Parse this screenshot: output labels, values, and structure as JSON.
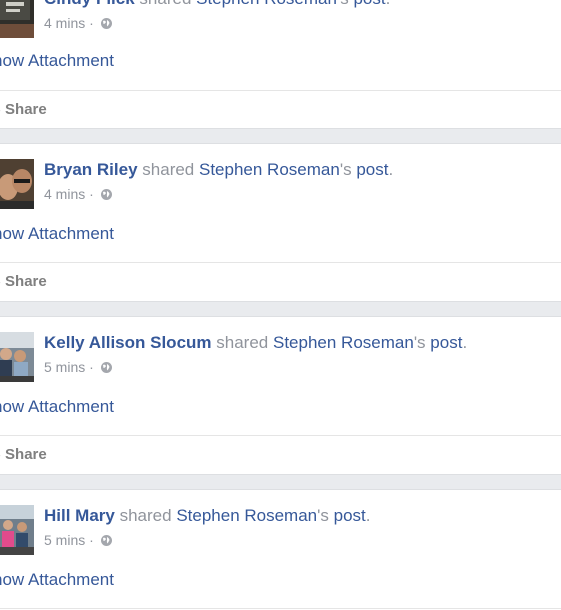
{
  "posts": [
    {
      "author": "Cindy Flick",
      "shared_word": "shared",
      "origin_author": "Stephen Roseman",
      "possessive": "'s",
      "post_word": "post",
      "period": ".",
      "time": "4 mins",
      "dot": "·",
      "attachment_label": "how Attachment",
      "share_label": "Share"
    },
    {
      "author": "Bryan Riley",
      "shared_word": "shared",
      "origin_author": "Stephen Roseman",
      "possessive": "'s",
      "post_word": "post",
      "period": ".",
      "time": "4 mins",
      "dot": "·",
      "attachment_label": "how Attachment",
      "share_label": "Share"
    },
    {
      "author": "Kelly Allison Slocum",
      "shared_word": "shared",
      "origin_author": "Stephen Roseman",
      "possessive": "'s",
      "post_word": "post",
      "period": ".",
      "time": "5 mins",
      "dot": "·",
      "attachment_label": "how Attachment",
      "share_label": "Share"
    },
    {
      "author": "Hill Mary",
      "shared_word": "shared",
      "origin_author": "Stephen Roseman",
      "possessive": "'s",
      "post_word": "post",
      "period": ".",
      "time": "5 mins",
      "dot": "·",
      "attachment_label": "how Attachment"
    }
  ],
  "icons": {
    "privacy": "globe-icon",
    "share": "share-arrow-icon"
  },
  "colors": {
    "link": "#365899",
    "meta": "#90949c",
    "background": "#e9ebee"
  }
}
